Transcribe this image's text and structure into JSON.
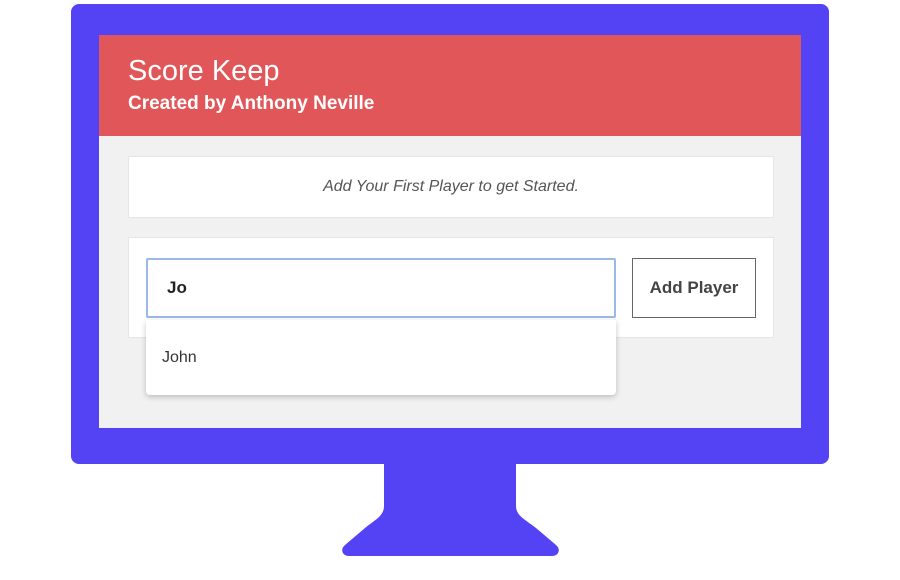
{
  "app": {
    "title": "Score Keep",
    "subtitle": "Created by Anthony Neville"
  },
  "message": {
    "text": "Add Your First Player to get Started."
  },
  "form": {
    "player_input_value": "Jo",
    "add_button_label": "Add Player"
  },
  "autocomplete": {
    "suggestions": [
      "John"
    ]
  },
  "colors": {
    "header_bg": "#e15658",
    "monitor": "#5442f5",
    "screen_bg": "#f1f1f1",
    "input_focus_border": "#9cb8ea"
  },
  "icons": {
    "monitor": "monitor-icon"
  }
}
